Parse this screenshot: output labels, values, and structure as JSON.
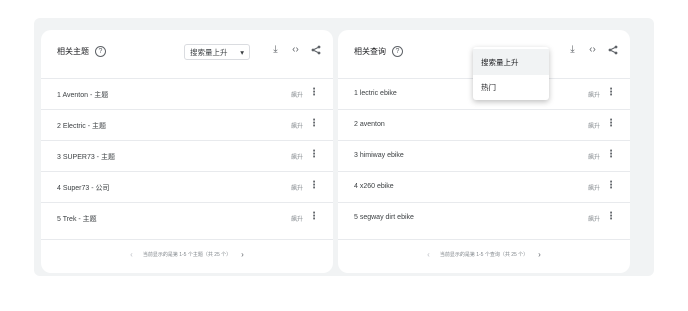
{
  "left_card": {
    "title": "相关主题",
    "help_glyph": "?",
    "select_value": "搜索量上升",
    "select_arrow": "▾",
    "icons": [
      "download-icon",
      "embed-icon",
      "share-icon"
    ],
    "rows": [
      {
        "label": "1  Aventon - 主题",
        "trend": "飙升"
      },
      {
        "label": "2  Electric - 主题",
        "trend": "飙升"
      },
      {
        "label": "3  SUPER73 - 主题",
        "trend": "飙升"
      },
      {
        "label": "4  Super73 - 公司",
        "trend": "飙升"
      },
      {
        "label": "5  Trek - 主题",
        "trend": "飙升"
      }
    ],
    "pager_text": "当前显示的是第 1-5 个主题（共 25 个）"
  },
  "right_card": {
    "title": "相关查询",
    "help_glyph": "?",
    "icons": [
      "download-icon",
      "embed-icon",
      "share-icon"
    ],
    "rows": [
      {
        "label": "1  lectric ebike",
        "trend": "飙升"
      },
      {
        "label": "2  aventon",
        "trend": "飙升"
      },
      {
        "label": "3  himiway ebike",
        "trend": "飙升"
      },
      {
        "label": "4  x260 ebike",
        "trend": "飙升"
      },
      {
        "label": "5  segway dirt ebike",
        "trend": "飙升"
      }
    ],
    "pager_text": "当前显示的是第 1-5 个查询（共 25 个）"
  },
  "dropdown": {
    "options": [
      "搜索量上升",
      "热门"
    ],
    "selected": "搜索量上升"
  },
  "glyphs": {
    "download": "⤓",
    "embed": "‹›",
    "share": "<",
    "more": "⋮",
    "prev": "‹",
    "next": "›"
  }
}
